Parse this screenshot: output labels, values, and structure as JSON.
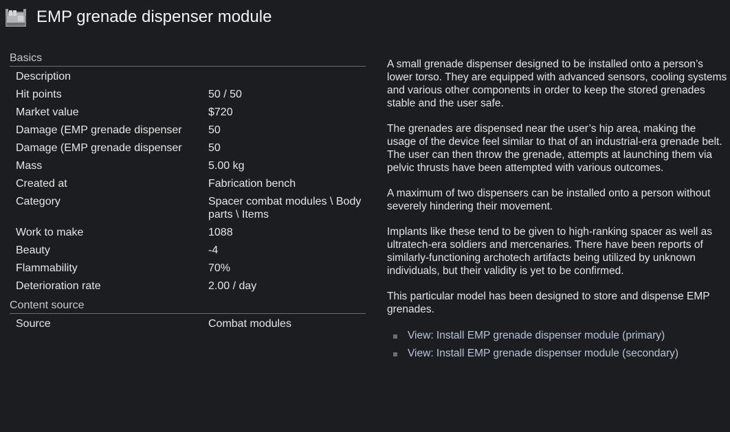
{
  "header": {
    "icon": "emp-grenade-dispenser-module-icon",
    "title": "EMP grenade dispenser module"
  },
  "basics": {
    "section_title": "Basics",
    "rows": [
      {
        "label": "Description",
        "value": ""
      },
      {
        "label": "Hit points",
        "value": "50 / 50"
      },
      {
        "label": "Market value",
        "value": "$720"
      },
      {
        "label": "Damage (EMP grenade dispenser",
        "value": "50"
      },
      {
        "label": "Damage (EMP grenade dispenser",
        "value": "50"
      },
      {
        "label": "Mass",
        "value": "5.00 kg"
      },
      {
        "label": "Created at",
        "value": "Fabrication bench"
      },
      {
        "label": "Category",
        "value": "Spacer combat modules \\ Body parts \\ Items"
      },
      {
        "label": "Work to make",
        "value": "1088"
      },
      {
        "label": "Beauty",
        "value": "-4"
      },
      {
        "label": "Flammability",
        "value": "70%"
      },
      {
        "label": "Deterioration rate",
        "value": "2.00 / day"
      }
    ]
  },
  "content_source": {
    "section_title": "Content source",
    "rows": [
      {
        "label": "Source",
        "value": "Combat modules"
      }
    ]
  },
  "description": {
    "paragraphs": [
      "A small grenade dispenser designed to be installed onto a person’s lower torso. They are equipped with advanced sensors, cooling systems and various other components in order to keep the stored grenades stable and the user safe.",
      "The grenades are dispensed near the user’s hip area, making the usage of the device feel similar to that of an industrial-era grenade belt. The user can then throw the grenade, attempts at launching them via pelvic thrusts have been attempted with various outcomes.",
      "A maximum of two dispensers can be installed onto a person without severely hindering their movement.",
      "Implants like these tend to be given to high-ranking spacer as well as ultratech-era soldiers and mercenaries. There have been reports of similarly-functioning archotech artifacts being utilized by unknown individuals, but their validity is yet to be confirmed.",
      "This particular model has been designed to store and dispense EMP grenades."
    ],
    "links": [
      "View: Install EMP grenade dispenser module (primary)",
      "View: Install EMP grenade dispenser module (secondary)"
    ]
  },
  "colors": {
    "background": "#1b1d21",
    "text": "#e6e6e6",
    "link": "#b9c4d8",
    "divider": "#6a6c70"
  }
}
